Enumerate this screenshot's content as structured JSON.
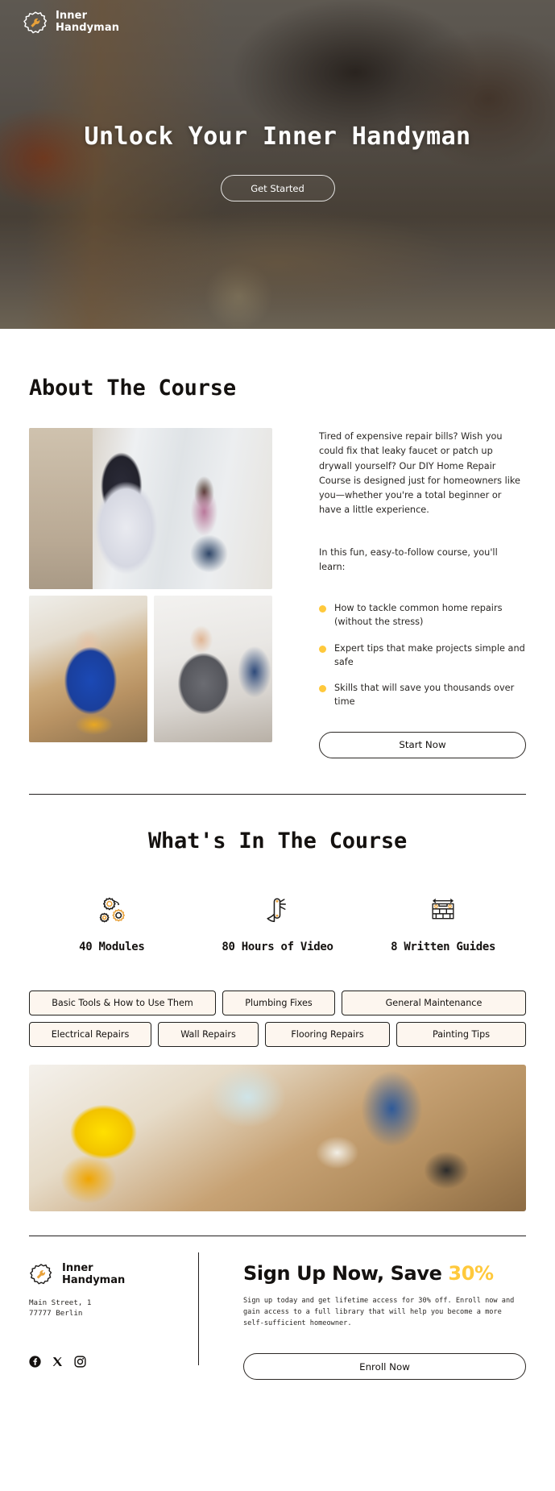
{
  "brand": {
    "name_line1": "Inner",
    "name_line2": "Handyman",
    "logo_icon": "gear-wrench-icon",
    "accent_color": "#ffc93c"
  },
  "hero": {
    "title": "Unlock Your Inner Handyman",
    "cta_label": "Get Started"
  },
  "about": {
    "heading": "About The Course",
    "paragraph_1": "Tired of expensive repair bills? Wish you could fix that leaky faucet or patch up drywall yourself? Our DIY Home Repair Course is designed just for homeowners like you—whether you're a total beginner or have a little experience.",
    "paragraph_2": "In this fun, easy-to-follow course, you'll learn:",
    "bullets": [
      "How to tackle common home repairs (without the stress)",
      "Expert tips that make projects simple and safe",
      "Skills that will save you thousands over time"
    ],
    "cta_label": "Start Now",
    "images": [
      {
        "alt": "man-drilling-wall-woman-watching"
      },
      {
        "alt": "man-on-ladder-kitchen-light-fixture"
      },
      {
        "alt": "man-sitting-floor-with-tools"
      }
    ]
  },
  "course": {
    "heading": "What's In The Course",
    "features": [
      {
        "icon": "gears-icon",
        "label": "40 Modules"
      },
      {
        "icon": "multitool-icon",
        "label": "80 Hours of Video"
      },
      {
        "icon": "brick-wall-icon",
        "label": "8 Written Guides"
      }
    ],
    "tag_rows": [
      [
        "Basic Tools & How to Use Them",
        "Plumbing Fixes",
        "General Maintenance"
      ],
      [
        "Electrical Repairs",
        "Wall Repairs",
        "Flooring Repairs",
        "Painting Tips"
      ]
    ],
    "banner_alt": "hard-hat-toolbox-and-workers-on-floor"
  },
  "footer": {
    "address_line1": "Main Street, 1",
    "address_line2": "77777 Berlin",
    "socials": [
      "facebook-icon",
      "x-icon",
      "instagram-icon"
    ],
    "signup_title_main": "Sign Up Now, Save ",
    "signup_title_accent": "30%",
    "signup_desc": "Sign up today and get lifetime access for 30% off. Enroll now and gain access to a full library that will help you become a more self-sufficient homeowner.",
    "cta_label": "Enroll Now"
  }
}
